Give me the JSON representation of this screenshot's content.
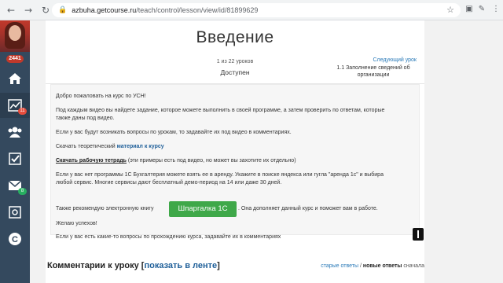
{
  "browser": {
    "back": "←",
    "forward": "→",
    "reload": "↻",
    "lock": "🔒",
    "url_domain": "azbuha.getcourse.ru",
    "url_path": "/teach/control/lesson/view/id/81899629",
    "star": "☆"
  },
  "sidebar": {
    "avatar_count": "2441",
    "items": [
      {
        "name": "home-icon",
        "badge": ""
      },
      {
        "name": "chart-icon",
        "badge": "11",
        "badge_color": "#e74c3c"
      },
      {
        "name": "users-icon",
        "badge": ""
      },
      {
        "name": "tasks-icon",
        "badge": ""
      },
      {
        "name": "mail-icon",
        "badge": "8",
        "badge_color": "#27ae60"
      },
      {
        "name": "safe-icon",
        "badge": ""
      },
      {
        "name": "chat-icon",
        "badge": ""
      }
    ]
  },
  "lesson": {
    "title": "Введение",
    "count": "1 из 22 уроков",
    "status": "Доступен",
    "next_label": "Следующий урок",
    "next_title": "1.1 Заполнение сведений об организации"
  },
  "body": {
    "p1": "Добро пожаловать на курс по УСН!",
    "p2a": "Под каждым видео вы найдете задание, которое можете выполнить в своей программе, а затем проверить по ответам, которые",
    "p2b": "также даны под видео.",
    "p3": "Если у вас будут возникать вопросы по урокам, то задавайте их под видео в комментариях.",
    "p4_text": "Скачать теоретический ",
    "p4_link": "материал к курсу",
    "p5_link": "Скачать рабочую тетрадь",
    "p5_text": " (эти примеры есть под видео, но может вы захотите их отдельно)",
    "p6a": "Если у вас нет программы 1С Бухгалтерия можете взять ее в аренду. Укажите в поиске яндекса или гугла \"аренда 1с\" и выбира",
    "p6b": "любой сервис. Многие сервисы дают бесплатный демо-период на 14 или даже 30 дней.",
    "p7a": "Также рекомендую электронную книгу",
    "p7_button": "Шпаргалка 1С",
    "p7b": ". Она дополняет данный курс и поможет вам в работе.",
    "p8": "Желаю успехов!",
    "p9": "Если у вас есть какие-то вопросы по прохождению курса, задавайте их в комментариях"
  },
  "comments": {
    "title": "Комментарии к уроку ",
    "bracket_open": "[",
    "show_feed": "показать в ленте",
    "bracket_close": "]",
    "old_first": "старые ответы",
    "sep": " / ",
    "new_first": "новые ответы",
    "first_suffix": " сначала"
  },
  "colors": {
    "sidebar": "#34495e",
    "link": "#1f5f99",
    "button_green": "#3fa849"
  }
}
